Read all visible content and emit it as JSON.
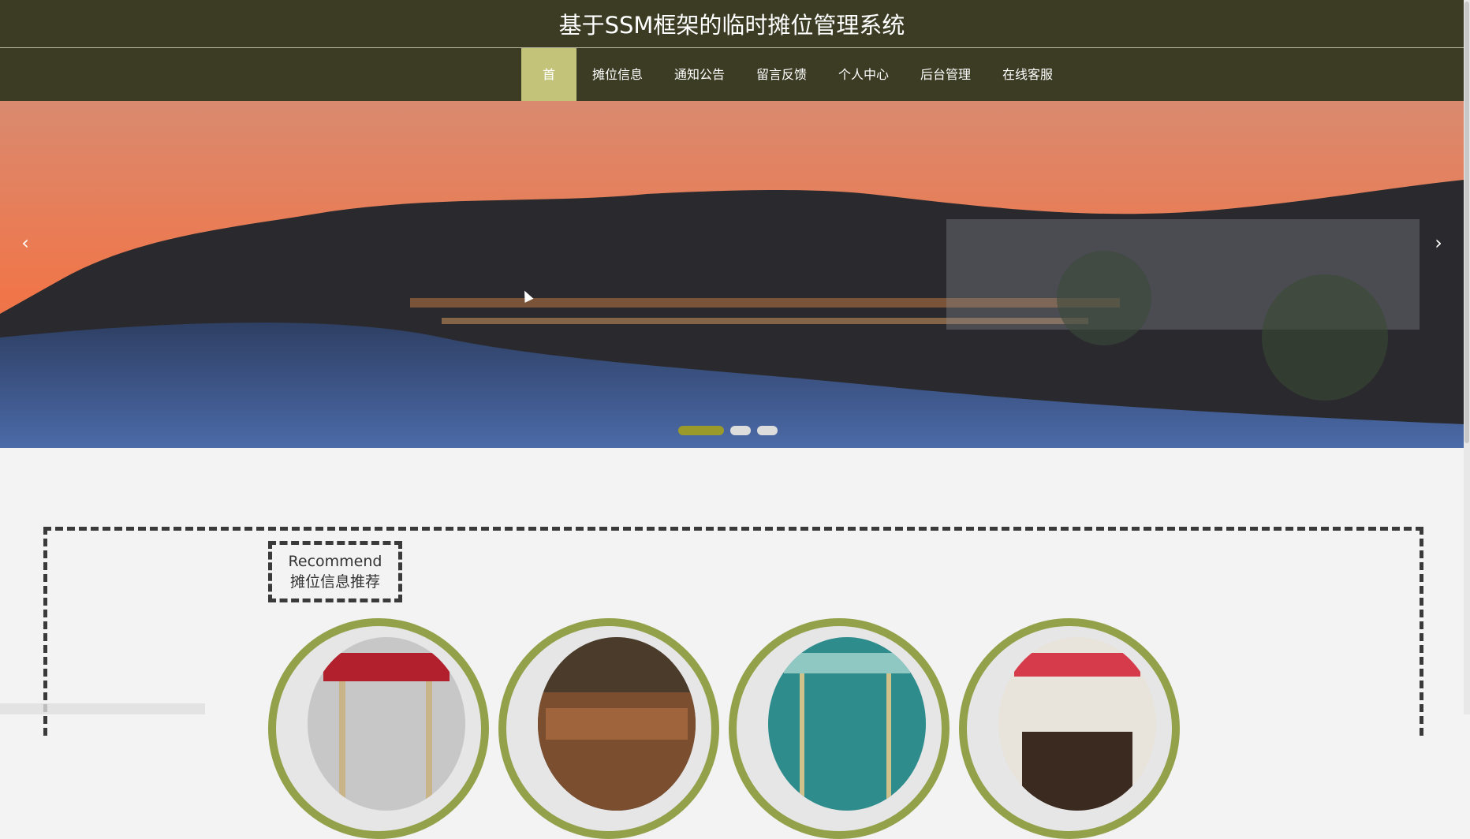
{
  "header": {
    "title": "基于SSM框架的临时摊位管理系统"
  },
  "nav": {
    "items": [
      {
        "label": "首页",
        "active": true
      },
      {
        "label": "摊位信息",
        "active": false
      },
      {
        "label": "通知公告",
        "active": false
      },
      {
        "label": "留言反馈",
        "active": false
      },
      {
        "label": "个人中心",
        "active": false
      },
      {
        "label": "后台管理",
        "active": false
      },
      {
        "label": "在线客服",
        "active": false
      }
    ]
  },
  "banner": {
    "prev_icon": "chevron-left-icon",
    "next_icon": "chevron-right-icon",
    "slides_count": 3,
    "active_slide": 1
  },
  "recommend": {
    "title_en": "Recommend",
    "title_cn": "摊位信息推荐"
  },
  "colors": {
    "header_bg": "#3c3c25",
    "nav_active": "#c3c37a",
    "card_ring": "#93a24a"
  }
}
